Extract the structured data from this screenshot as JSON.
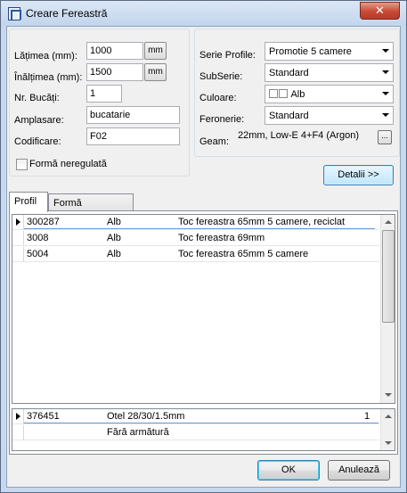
{
  "window": {
    "title": "Creare Fereastră",
    "close_label": "✕"
  },
  "left_form": {
    "latime_label": "Lățimea (mm):",
    "latime_value": "1000",
    "latime_unit": "mm",
    "inaltime_label": "Înălțimea (mm):",
    "inaltime_value": "1500",
    "inaltime_unit": "mm",
    "bucati_label": "Nr. Bucăți:",
    "bucati_value": "1",
    "amplasare_label": "Amplasare:",
    "amplasare_value": "bucatarie",
    "codificare_label": "Codificare:",
    "codificare_value": "F02",
    "forma_checkbox_label": "Formă neregulată",
    "forma_checked": false
  },
  "right_form": {
    "serie_label": "Serie Profile:",
    "serie_value": "Promotie 5 camere",
    "subserie_label": "SubSerie:",
    "subserie_value": "Standard",
    "culoare_label": "Culoare:",
    "culoare_value": "Alb",
    "feronerie_label": "Feronerie:",
    "feronerie_value": "Standard",
    "geam_label": "Geam:",
    "geam_value": "22mm, Low-E 4+F4 (Argon)",
    "geam_button": "...",
    "details_button": "Detalii >>"
  },
  "tabs": [
    {
      "label": "Profil"
    },
    {
      "label": "Formă neregulată"
    }
  ],
  "profile_grid": {
    "rows": [
      {
        "code": "300287",
        "color": "Alb",
        "description": "Toc fereastra 65mm 5 camere, reciclat"
      },
      {
        "code": "3008",
        "color": "Alb",
        "description": "Toc fereastra 69mm"
      },
      {
        "code": "5004",
        "color": "Alb",
        "description": "Toc fereastra 65mm 5 camere"
      }
    ]
  },
  "reinforcement_grid": {
    "rows": [
      {
        "code": "376451",
        "description": "Otel 28/30/1.5mm",
        "qty": "1"
      },
      {
        "code": "",
        "description": "Fără armătură",
        "qty": ""
      }
    ]
  },
  "footer": {
    "ok_label": "OK",
    "cancel_label": "Anulează"
  }
}
